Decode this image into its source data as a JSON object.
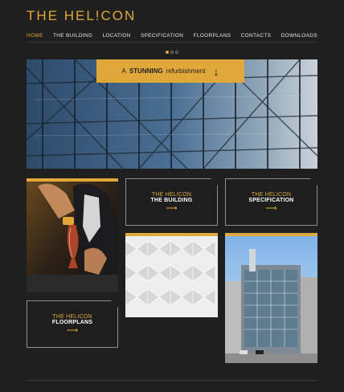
{
  "logo": {
    "text": "THE HEL!CON"
  },
  "nav": {
    "items": [
      {
        "label": "HOME"
      },
      {
        "label": "THE BUILDING"
      },
      {
        "label": "LOCATION"
      },
      {
        "label": "SPECIFICATION"
      },
      {
        "label": "FLOORPLANS"
      },
      {
        "label": "CONTACTS"
      },
      {
        "label": "DOWNLOADS"
      }
    ]
  },
  "hero": {
    "prefix": "A",
    "emphasis": "STUNNING",
    "suffix": "refurbishment",
    "arrow": "↓"
  },
  "tiles": {
    "building": {
      "line1": "THE HELICON",
      "line2": "THE BUILDING",
      "arrow": "⟶"
    },
    "spec": {
      "line1": "THE HELICON",
      "line2": "SPECIFICATION",
      "arrow": "⟶"
    },
    "floor": {
      "line1": "THE HELICON",
      "line2": "FLOORPLANS",
      "arrow": "⟶"
    }
  },
  "colors": {
    "accent": "#e0a83a",
    "background": "#1f1f1f"
  }
}
